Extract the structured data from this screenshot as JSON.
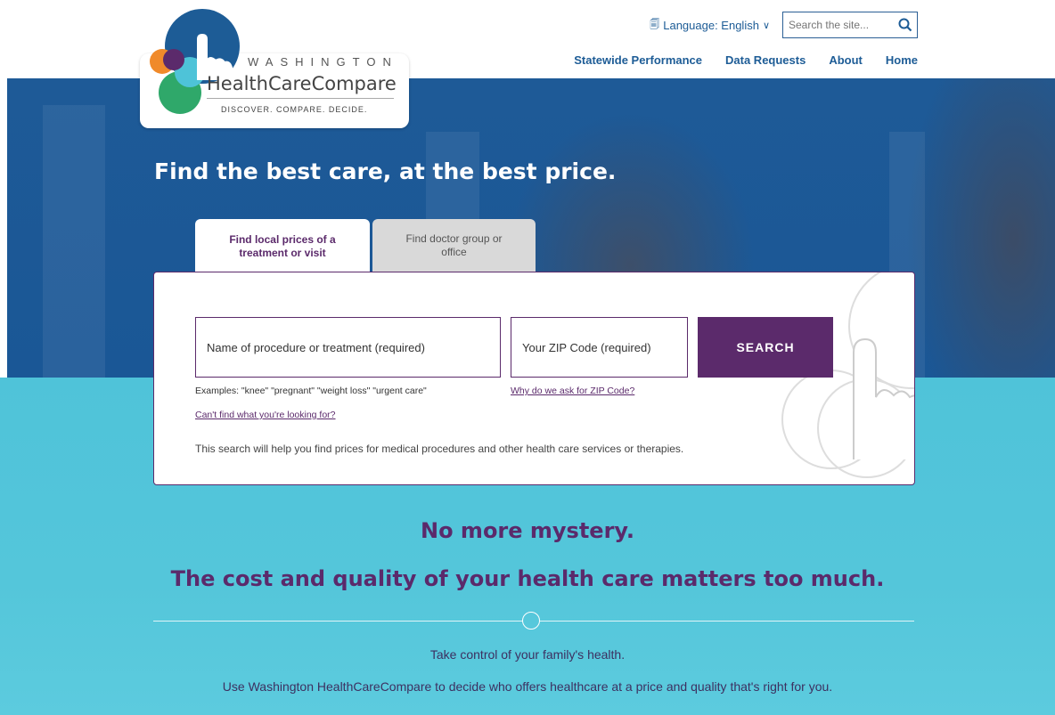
{
  "header": {
    "language_label": "Language: English",
    "search_placeholder": "Search the site...",
    "nav": [
      "Statewide Performance",
      "Data Requests",
      "About",
      "Home"
    ]
  },
  "logo": {
    "state": "WASHINGTON",
    "brand": "HealthCareCompare",
    "tagline": "DISCOVER. COMPARE. DECIDE."
  },
  "hero": {
    "headline": "Find the best care, at the best price."
  },
  "tabs": {
    "active": "Find local prices of a treatment or visit",
    "inactive": "Find doctor group or office"
  },
  "search": {
    "procedure_placeholder": "Name of procedure or treatment (required)",
    "zip_placeholder": "Your ZIP Code (required)",
    "button_label": "SEARCH",
    "examples": "Examples: \"knee\" \"pregnant\" \"weight loss\" \"urgent care\"",
    "zip_why": "Why do we ask for ZIP Code?",
    "cant_find": "Can't find what you're looking for?",
    "description": "This search will help you find prices for medical procedures and other health care services or therapies."
  },
  "lower": {
    "mystery": "No more mystery.",
    "matters": "The cost and quality of your health care matters too much.",
    "take_control": "Take control of your family's health.",
    "use_text": "Use Washington HealthCareCompare to decide who offers healthcare at a price and quality that's right for you."
  },
  "colors": {
    "brand_blue": "#1d5c96",
    "brand_purple": "#5b2a6b",
    "teal": "#4fc3d9"
  }
}
